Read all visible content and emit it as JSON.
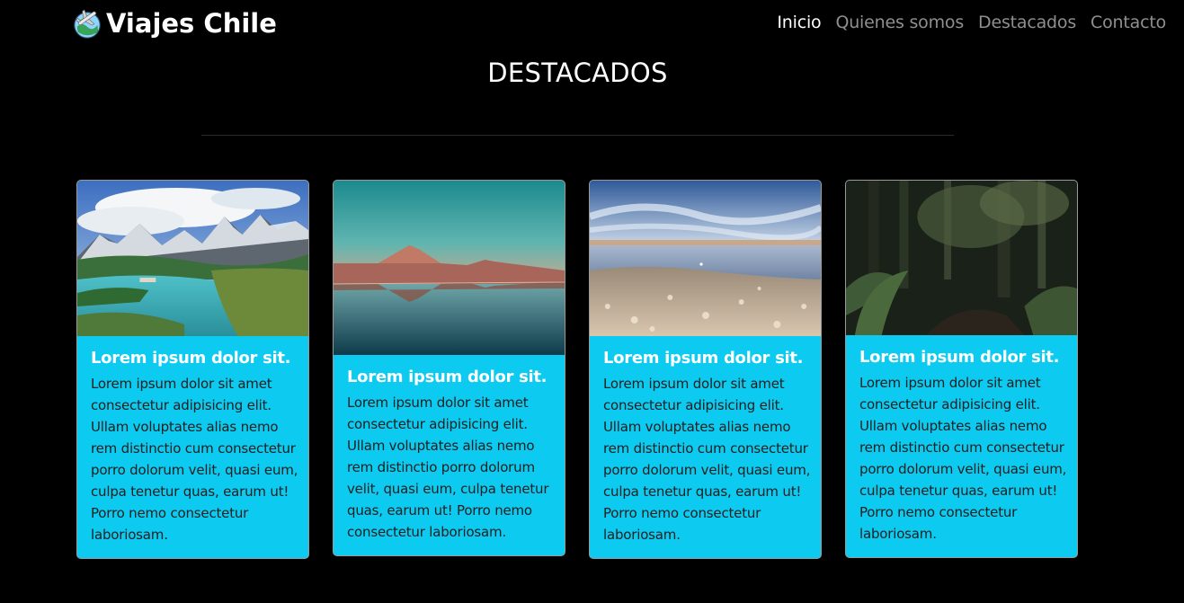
{
  "navbar": {
    "brand": "Viajes Chile",
    "links": [
      {
        "label": "Inicio",
        "active": true
      },
      {
        "label": "Quienes somos",
        "active": false
      },
      {
        "label": "Destacados",
        "active": false
      },
      {
        "label": "Contacto",
        "active": false
      }
    ]
  },
  "section": {
    "title": "DESTACADOS"
  },
  "cards": [
    {
      "image": "torres-del-paine-lake-photo",
      "title": "Lorem ipsum dolor sit.",
      "text": "Lorem ipsum dolor sit amet consectetur adipisicing elit. Ullam voluptates alias nemo rem distinctio cum consectetur porro dolorum velit, quasi eum, culpa tenetur quas, earum ut! Porro nemo consectetur laboriosam."
    },
    {
      "image": "desert-volcano-reflection-photo",
      "title": "Lorem ipsum dolor sit.",
      "text": "Lorem ipsum dolor sit amet consectetur adipisicing elit. Ullam voluptates alias nemo rem distinctio porro dolorum velit, quasi eum, culpa tenetur quas, earum ut! Porro nemo consectetur laboriosam."
    },
    {
      "image": "salt-flat-lagoon-photo",
      "title": "Lorem ipsum dolor sit.",
      "text": "Lorem ipsum dolor sit amet consectetur adipisicing elit. Ullam voluptates alias nemo rem distinctio cum consectetur porro dolorum velit, quasi eum, culpa tenetur quas, earum ut! Porro nemo consectetur laboriosam."
    },
    {
      "image": "forest-trail-photo",
      "title": "Lorem ipsum dolor sit.",
      "text": "Lorem ipsum dolor sit amet consectetur adipisicing elit. Ullam voluptates alias nemo rem distinctio cum consectetur porro dolorum velit, quasi eum, culpa tenetur quas, earum ut! Porro nemo consectetur laboriosam."
    }
  ],
  "colors": {
    "background": "#000000",
    "card": "#0ccaf0",
    "nav_active": "#ffffff",
    "nav_inactive": "#8f8f8f"
  }
}
